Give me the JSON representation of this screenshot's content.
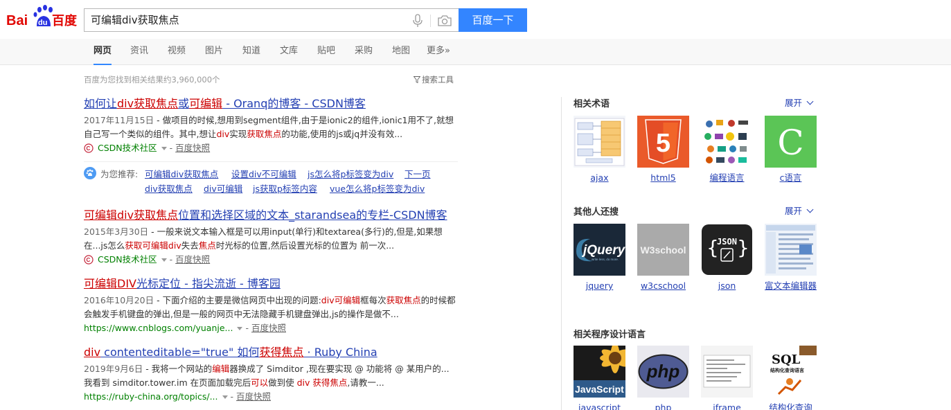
{
  "header": {
    "logo_text_left": "Bai",
    "logo_text_paw": "du",
    "logo_text_right": "百度",
    "query": "可编辑div获取焦点",
    "search_button": "百度一下"
  },
  "nav": {
    "items": [
      "网页",
      "资讯",
      "视频",
      "图片",
      "知道",
      "文库",
      "贴吧",
      "采购",
      "地图",
      "更多»"
    ],
    "active": "网页"
  },
  "stats": {
    "text": "百度为您找到相关结果约3,960,000个",
    "tools": "搜索工具"
  },
  "results": [
    {
      "title_parts": [
        [
          "如何让",
          false
        ],
        [
          "div获取焦点",
          true
        ],
        [
          "或",
          false
        ],
        [
          "可编辑",
          true
        ],
        [
          " - Oranq的博客 - CSDN博客",
          false
        ]
      ],
      "date": "2017年11月15日",
      "abstract_parts": [
        [
          " - 做项目的时候,想用到segment组件,由于是ionic2的组件,ionic1用不了,就想自己写一个类似的组件。其中,想让",
          false
        ],
        [
          "div",
          true
        ],
        [
          "实现",
          false
        ],
        [
          "获取焦点",
          true
        ],
        [
          "的功能,使用的js或jq并没有效...",
          false
        ]
      ],
      "source": "CSDN技术社区",
      "cache": "百度快照"
    },
    {
      "title_parts": [
        [
          "可编辑div获取焦点",
          true
        ],
        [
          "位置和选择区域的文本_starandsea的专栏-CSDN博客",
          false
        ]
      ],
      "date": "2015年3月30日",
      "abstract_parts": [
        [
          " - 一般来说文本输入框是可以用input(单行)和textarea(多行)的,但是,如果想在...js怎么",
          false
        ],
        [
          "获取可编辑div",
          true
        ],
        [
          "失去",
          false
        ],
        [
          "焦点",
          true
        ],
        [
          "时光标的位置,然后设置光标的位置为 前一次...",
          false
        ]
      ],
      "source": "CSDN技术社区",
      "cache": "百度快照"
    },
    {
      "title_parts": [
        [
          "可编辑DIV",
          true
        ],
        [
          "光标定位 - 指尖流逝 - 博客园",
          false
        ]
      ],
      "date": "2016年10月20日",
      "abstract_parts": [
        [
          " - 下面介绍的主要是微信网页中出现的问题:",
          false
        ],
        [
          "div可编辑",
          true
        ],
        [
          "框每次",
          false
        ],
        [
          "获取焦点",
          true
        ],
        [
          "的时候都会触发手机键盘的弹出,但是一般的网页中无法隐藏手机键盘弹出,js的操作是做不...",
          false
        ]
      ],
      "url": "https://www.cnblogs.com/yuanje...",
      "cache": "百度快照"
    },
    {
      "title_parts": [
        [
          "div",
          true
        ],
        [
          " contenteditable=\"true\" 如何",
          false
        ],
        [
          "获得焦点",
          true
        ],
        [
          " · Ruby China",
          false
        ]
      ],
      "date": "2019年9月6日",
      "abstract_parts": [
        [
          " - 我将一个网站的",
          false
        ],
        [
          "编辑",
          true
        ],
        [
          "器换成了 Simditor ,现在要实现 @ 功能将 @ 某用户的...我看到 simditor.tower.im 在页面加载完后",
          false
        ],
        [
          "可以",
          true
        ],
        [
          "做到使 ",
          false
        ],
        [
          "div 获得焦点",
          true
        ],
        [
          ",请教一...",
          false
        ]
      ],
      "url": "https://ruby-china.org/topics/...",
      "cache": "百度快照"
    }
  ],
  "recommend": {
    "label": "为您推荐:",
    "links": [
      "可编辑div获取焦点",
      "设置div不可编辑",
      "js怎么将p标签变为div",
      "下一页",
      "div获取焦点",
      "div可编辑",
      "js获取p标签内容",
      "vue怎么将p标签变为div"
    ]
  },
  "sidebar": {
    "sections": [
      {
        "title": "相关术语",
        "expand": "展开",
        "items": [
          "ajax",
          "html5",
          "编程语言",
          "c语言"
        ]
      },
      {
        "title": "其他人还搜",
        "expand": "展开",
        "items": [
          "jquery",
          "w3cschool",
          "json",
          "富文本编辑器"
        ]
      },
      {
        "title": "相关程序设计语言",
        "items": [
          "javascript",
          "php",
          "iframe",
          "结构化查询"
        ]
      }
    ],
    "thumb_text": {
      "html5": "5",
      "c": "C",
      "jquery": "jQuery",
      "jquery_sub": "write less, do more.",
      "w3school": "W3school",
      "json": "JSON",
      "js": "JavaScript",
      "php": "php",
      "sql": "SQL",
      "sql_sub": "结构化查询语言"
    }
  },
  "colors": {
    "accent": "#3385ff",
    "link": "#2440b3",
    "highlight": "#cc0000",
    "url_green": "#008000"
  }
}
